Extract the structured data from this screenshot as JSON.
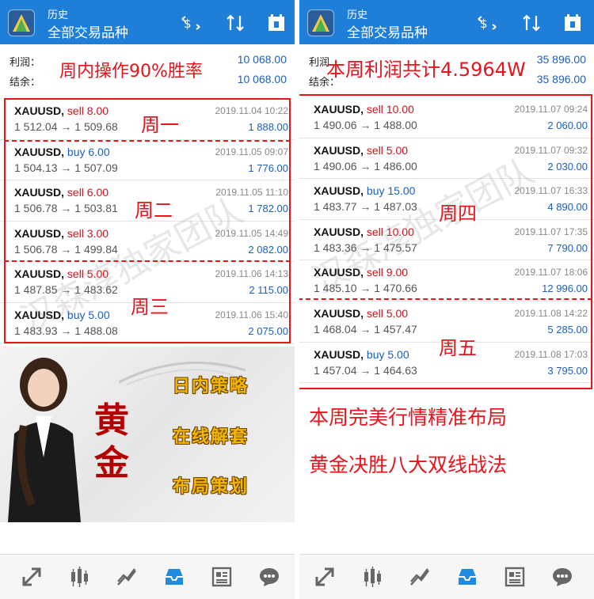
{
  "left": {
    "header": {
      "subtitle": "历史",
      "title": "全部交易品种"
    },
    "summary": {
      "profit_label": "利润：",
      "profit_value": "10 068.00",
      "balance_label": "结余：",
      "balance_value": "10 068.00"
    },
    "promo": "周内操作90%胜率",
    "trades": [
      {
        "symbol": "XAUUSD,",
        "side": "sell 8.00",
        "type": "sell",
        "prices": "1 512.04 → 1 509.68",
        "date": "2019.11.04 10:22",
        "profit": "1 888.00"
      },
      {
        "symbol": "XAUUSD,",
        "side": "buy 6.00",
        "type": "buy",
        "prices": "1 504.13 → 1 507.09",
        "date": "2019.11.05 09:07",
        "profit": "1 776.00"
      },
      {
        "symbol": "XAUUSD,",
        "side": "sell 6.00",
        "type": "sell",
        "prices": "1 506.78 → 1 503.81",
        "date": "2019.11.05 11:10",
        "profit": "1 782.00"
      },
      {
        "symbol": "XAUUSD,",
        "side": "sell 3.00",
        "type": "sell",
        "prices": "1 506.78 → 1 499.84",
        "date": "2019.11.05 14:49",
        "profit": "2 082.00"
      },
      {
        "symbol": "XAUUSD,",
        "side": "sell 5.00",
        "type": "sell",
        "prices": "1 487.85 → 1 483.62",
        "date": "2019.11.06 14:13",
        "profit": "2 115.00"
      },
      {
        "symbol": "XAUUSD,",
        "side": "buy 5.00",
        "type": "buy",
        "prices": "1 483.93 → 1 488.08",
        "date": "2019.11.06 15:40",
        "profit": "2 075.00"
      }
    ],
    "days": [
      "周一",
      "周二",
      "周三"
    ],
    "banner": {
      "gold_text": [
        "黄",
        "金"
      ],
      "taglines": [
        "日内策略",
        "在线解套",
        "布局策划"
      ]
    }
  },
  "right": {
    "header": {
      "subtitle": "历史",
      "title": "全部交易品种"
    },
    "summary": {
      "profit_label": "利润",
      "profit_value": "35 896.00",
      "balance_label": "结余：",
      "balance_value": "35 896.00"
    },
    "promo": "本周利润共计4.5964W",
    "trades": [
      {
        "symbol": "XAUUSD,",
        "side": "sell 10.00",
        "type": "sell",
        "prices": "1 490.06 → 1 488.00",
        "date": "2019.11.07 09:24",
        "profit": "2 060.00"
      },
      {
        "symbol": "XAUUSD,",
        "side": "sell 5.00",
        "type": "sell",
        "prices": "1 490.06 → 1 486.00",
        "date": "2019.11.07 09:32",
        "profit": "2 030.00"
      },
      {
        "symbol": "XAUUSD,",
        "side": "buy 15.00",
        "type": "buy",
        "prices": "1 483.77 → 1 487.03",
        "date": "2019.11.07 16:33",
        "profit": "4 890.00"
      },
      {
        "symbol": "XAUUSD,",
        "side": "sell 10.00",
        "type": "sell",
        "prices": "1 483.36 → 1 475.57",
        "date": "2019.11.07 17:35",
        "profit": "7 790.00"
      },
      {
        "symbol": "XAUUSD,",
        "side": "sell 9.00",
        "type": "sell",
        "prices": "1 485.10 → 1 470.66",
        "date": "2019.11.07 18:06",
        "profit": "12 996.00"
      },
      {
        "symbol": "XAUUSD,",
        "side": "sell 5.00",
        "type": "sell",
        "prices": "1 468.04 → 1 457.47",
        "date": "2019.11.08 14:22",
        "profit": "5 285.00"
      },
      {
        "symbol": "XAUUSD,",
        "side": "buy 5.00",
        "type": "buy",
        "prices": "1 457.04 → 1 464.63",
        "date": "2019.11.08 17:03",
        "profit": "3 795.00"
      }
    ],
    "days": [
      "周四",
      "周五"
    ],
    "slogans": [
      "本周完美行情精准布局",
      "黄金决胜八大双线战法"
    ]
  },
  "watermark": "汉森淳独家团队",
  "colors": {
    "header_blue": "#1f7fd8",
    "sell_red": "#d0121b",
    "buy_blue": "#1a60c0",
    "promo_red": "#e8141c",
    "gold": "#f2b600"
  },
  "tab_icons": [
    "trade-icon",
    "quotes-icon",
    "chart-icon",
    "history-icon",
    "news-icon",
    "chat-icon"
  ]
}
